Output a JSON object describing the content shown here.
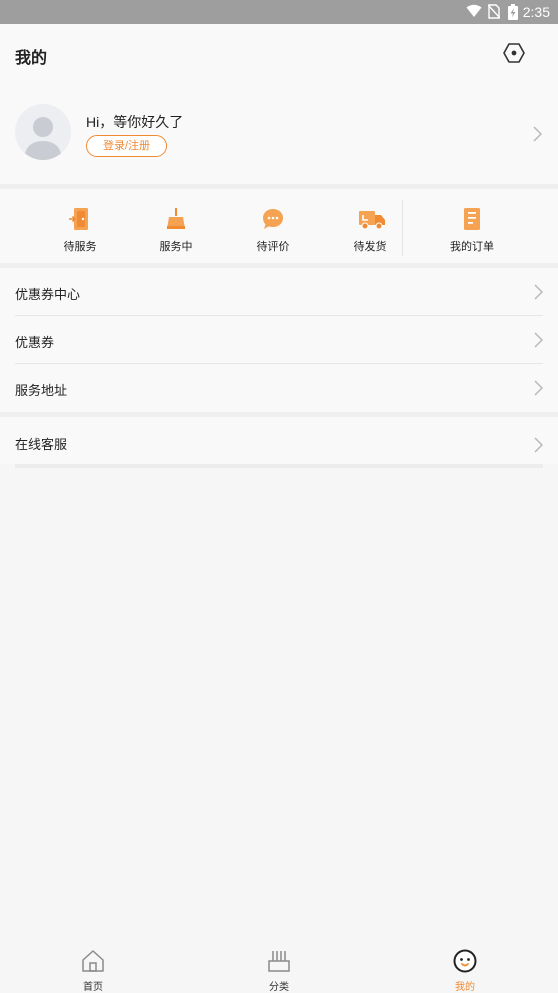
{
  "status_bar": {
    "time": "2:35",
    "icons": [
      "wifi-icon",
      "no-sim-icon",
      "battery-charging-icon"
    ]
  },
  "header": {
    "title": "我的",
    "settings_icon": "settings-hexagon-icon"
  },
  "profile": {
    "greeting": "Hi，等你好久了",
    "login_label": "登录/注册",
    "avatar_icon": "default-avatar-icon"
  },
  "orders": [
    {
      "label": "待服务",
      "icon": "door-icon"
    },
    {
      "label": "服务中",
      "icon": "broom-icon"
    },
    {
      "label": "待评价",
      "icon": "chat-bubble-icon"
    },
    {
      "label": "待发货",
      "icon": "delivery-truck-icon"
    },
    {
      "label": "我的订单",
      "icon": "order-list-icon"
    }
  ],
  "menu": {
    "items": [
      {
        "label": "优惠券中心"
      },
      {
        "label": "优惠券"
      },
      {
        "label": "服务地址"
      },
      {
        "label": "在线客服"
      }
    ]
  },
  "tabbar": {
    "tabs": [
      {
        "label": "首页",
        "icon": "home-icon",
        "active": false
      },
      {
        "label": "分类",
        "icon": "category-icon",
        "active": false
      },
      {
        "label": "我的",
        "icon": "mine-face-icon",
        "active": true
      }
    ]
  },
  "colors": {
    "accent": "#f08a33",
    "background": "#f6f6f6",
    "status_bar": "#9e9e9e"
  }
}
